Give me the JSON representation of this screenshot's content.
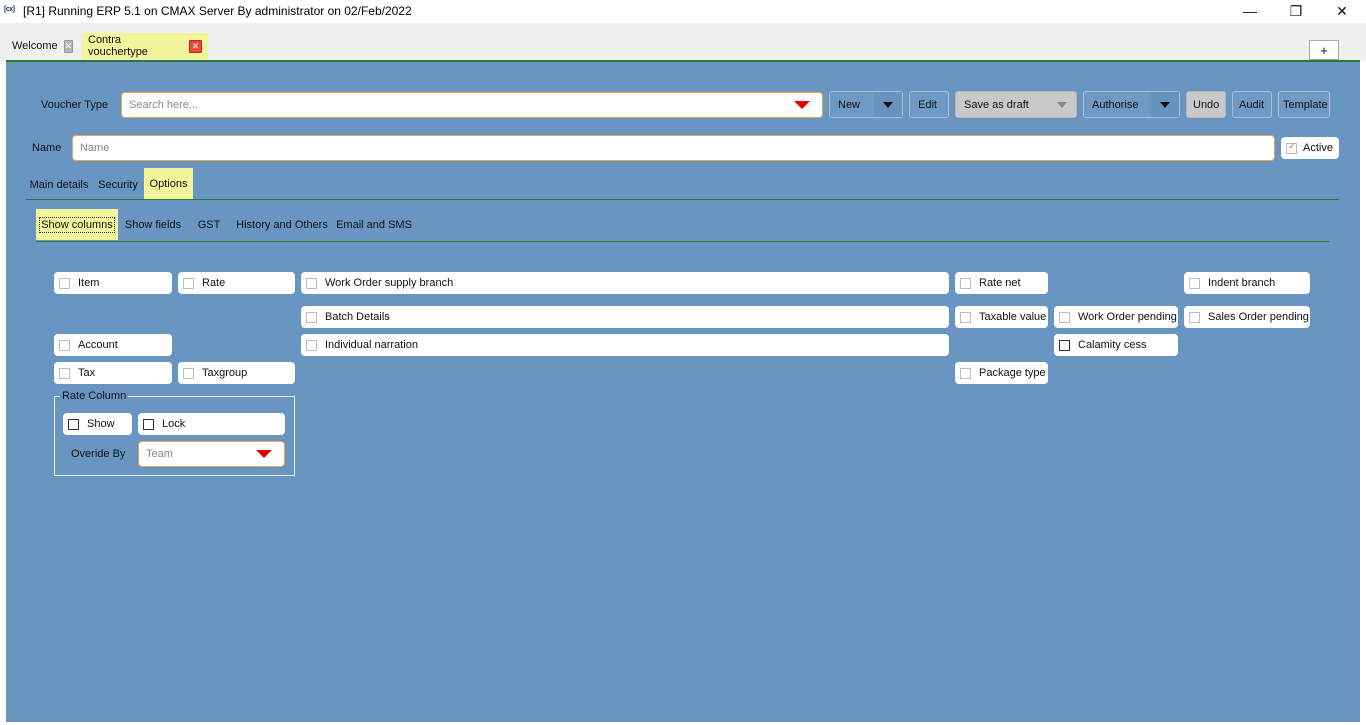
{
  "window": {
    "app_icon": "[cx]",
    "title": "[R1] Running ERP 5.1 on CMAX Server By administrator on 02/Feb/2022",
    "min_glyph": "—",
    "restore_glyph": "❐",
    "close_glyph": "✕"
  },
  "tabs": [
    {
      "label": "Welcome",
      "close_glyph": "✕"
    },
    {
      "label": "Contra vouchertype",
      "close_glyph": "✕"
    }
  ],
  "plus_label": "+",
  "toolbar": {
    "voucher_type_label": "Voucher Type",
    "search_placeholder": "Search here...",
    "new_label": "New",
    "edit_label": "Edit",
    "save_draft_label": "Save as draft",
    "authorise_label": "Authorise",
    "undo_label": "Undo",
    "audit_label": "Audit",
    "template_label": "Template"
  },
  "name_row": {
    "label": "Name",
    "placeholder": "Name",
    "active_label": "Active",
    "active_checked": true
  },
  "main_tabs": [
    "Main details",
    "Security",
    "Options"
  ],
  "sub_tabs": [
    "Show columns",
    "Show fields",
    "GST",
    "History and Others",
    "Email and SMS"
  ],
  "columns": {
    "item": "Item",
    "rate": "Rate",
    "work_order_supply_branch": "Work Order supply branch",
    "rate_net": "Rate net",
    "indent_branch": "Indent branch",
    "batch_details": "Batch Details",
    "taxable_value": "Taxable value",
    "work_order_pending": "Work Order pending",
    "sales_order_pending": "Sales Order pending",
    "account": "Account",
    "individual_narration": "Individual narration",
    "calamity_cess": "Calamity cess",
    "tax": "Tax",
    "taxgroup": "Taxgroup",
    "package_type": "Package type"
  },
  "rate_column": {
    "legend": "Rate Column",
    "show_label": "Show",
    "lock_label": "Lock",
    "override_label": "Overide By",
    "override_placeholder": "Team"
  },
  "colors": {
    "panel": "#6895c2",
    "highlight": "#f2f59a",
    "accent_border": "#e3a94a",
    "rule": "#2d7a2d"
  }
}
